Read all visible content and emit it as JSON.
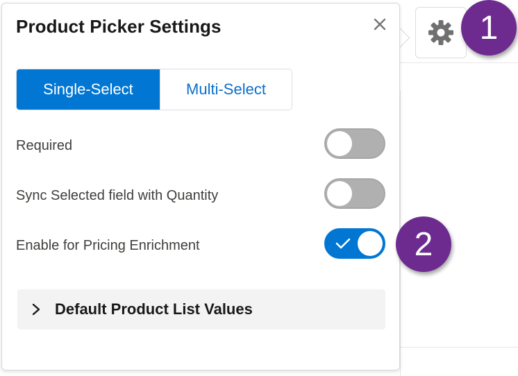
{
  "panel": {
    "title": "Product Picker Settings",
    "close_icon": "close-icon"
  },
  "selection_mode": {
    "options": [
      "Single-Select",
      "Multi-Select"
    ],
    "selected": "Single-Select"
  },
  "settings": [
    {
      "label": "Required",
      "enabled": false
    },
    {
      "label": "Sync Selected field with Quantity",
      "enabled": false
    },
    {
      "label": "Enable for Pricing Enrichment",
      "enabled": true
    }
  ],
  "accordion": {
    "label": "Default Product List Values",
    "expanded": false
  },
  "gear_button": {
    "icon": "gear-icon"
  },
  "callouts": [
    "1",
    "2"
  ],
  "colors": {
    "brand_blue": "#0176d3",
    "callout_purple": "#6d2b8f",
    "toggle_off": "#b0b0b0"
  }
}
